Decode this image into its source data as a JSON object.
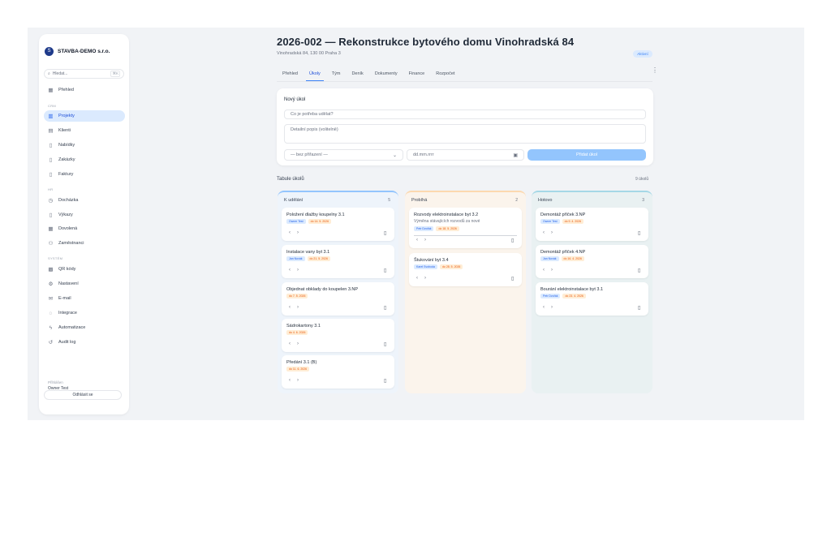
{
  "sidebar": {
    "brand": "STAVBA-DEMO s.r.o.",
    "brand_initial": "S",
    "search_placeholder": "Hledat...",
    "search_shortcut": "⌘K",
    "items": [
      {
        "label": "Přehled",
        "icon": "dashboard-icon"
      },
      {
        "label": "Projekty",
        "icon": "building-icon"
      },
      {
        "label": "Klienti",
        "icon": "clients-icon"
      },
      {
        "label": "Nabídky",
        "icon": "quote-icon"
      },
      {
        "label": "Zakázky",
        "icon": "order-icon"
      },
      {
        "label": "Faktury",
        "icon": "invoice-icon"
      },
      {
        "label": "Docházka",
        "icon": "clock-icon"
      },
      {
        "label": "Výkazy",
        "icon": "report-icon"
      },
      {
        "label": "Dovolená",
        "icon": "calendar-icon"
      },
      {
        "label": "Zaměstnanci",
        "icon": "people-icon"
      },
      {
        "label": "QR kódy",
        "icon": "qr-icon"
      },
      {
        "label": "Nastavení",
        "icon": "gear-icon"
      },
      {
        "label": "E-mail",
        "icon": "mail-icon"
      },
      {
        "label": "Integrace",
        "icon": "plug-icon"
      },
      {
        "label": "Automatizace",
        "icon": "automation-icon"
      },
      {
        "label": "Audit log",
        "icon": "history-icon"
      }
    ],
    "sections": [
      "CRM",
      "HR",
      "SYSTÉM"
    ],
    "user_label": "Přihlášen",
    "user_name": "Owner Test",
    "logout_label": "Odhlásit se"
  },
  "header": {
    "title": "2026-002 — Rekonstrukce bytového domu Vinohradská 84",
    "subtitle": "Vinohradská 84, 130 00 Praha 3",
    "status": "Aktivní"
  },
  "tabs": [
    "Přehled",
    "Úkoly",
    "Tým",
    "Deník",
    "Dokumenty",
    "Finance",
    "Rozpočet"
  ],
  "new_task": {
    "heading": "Nový úkol",
    "title_placeholder": "Co je potřeba udělat?",
    "desc_placeholder": "Detailní popis (volitelně)",
    "assignee": "— bez přiřazení —",
    "date_placeholder": "dd.mm.rrrr",
    "submit": "Přidat úkol"
  },
  "board": {
    "title": "Tabule úkolů",
    "count": "9 úkolů",
    "columns": [
      {
        "name": "K udělání",
        "count": "5",
        "cards": [
          {
            "title": "Položení dlažby koupelny 3.1",
            "tags": [
              "Owner Test",
              "do 14. 5. 2026"
            ]
          },
          {
            "title": "Instalace vany byt 3.1",
            "tags": [
              "Jan Novák",
              "do 21. 5. 2026"
            ]
          },
          {
            "title": "Objednat obklady do koupelen 3.NP",
            "tags": [
              "do 7. 5. 2026"
            ]
          },
          {
            "title": "Sádrokartony 3.1",
            "tags": [
              "do 4. 6. 2026"
            ]
          },
          {
            "title": "Předání 3.1 (B)",
            "tags": [
              "do 11. 6. 2026"
            ]
          }
        ]
      },
      {
        "name": "Probíhá",
        "count": "2",
        "cards": [
          {
            "title": "Rozvody elektroinstalace byt 3.2",
            "desc": "Výměna stávajících rozvodů za nové",
            "tags": [
              "Petr Dvořák",
              "do 18. 5. 2026"
            ]
          },
          {
            "title": "Štukování byt 3.4",
            "tags": [
              "Karel Svoboda",
              "do 28. 5. 2026"
            ]
          }
        ]
      },
      {
        "name": "Hotovo",
        "count": "3",
        "cards": [
          {
            "title": "Demontáž příček 3.NP",
            "tags": [
              "Owner Test",
              "do 9. 4. 2026"
            ]
          },
          {
            "title": "Demontáž příček 4.NP",
            "tags": [
              "Jan Novák",
              "do 16. 4. 2026"
            ]
          },
          {
            "title": "Bourání elektroinstalace byt 3.1",
            "tags": [
              "Petr Dvořák",
              "do 23. 4. 2026"
            ]
          }
        ]
      }
    ]
  },
  "colors": {
    "accent": "#3b82f6",
    "todo_border": "#93c5fd",
    "todo_bg": "#eef4fb",
    "progress_border": "#fcd9b0",
    "progress_bg": "#fbf4ec",
    "done_border": "#a5d8e6",
    "done_bg": "#e9f1f2"
  }
}
